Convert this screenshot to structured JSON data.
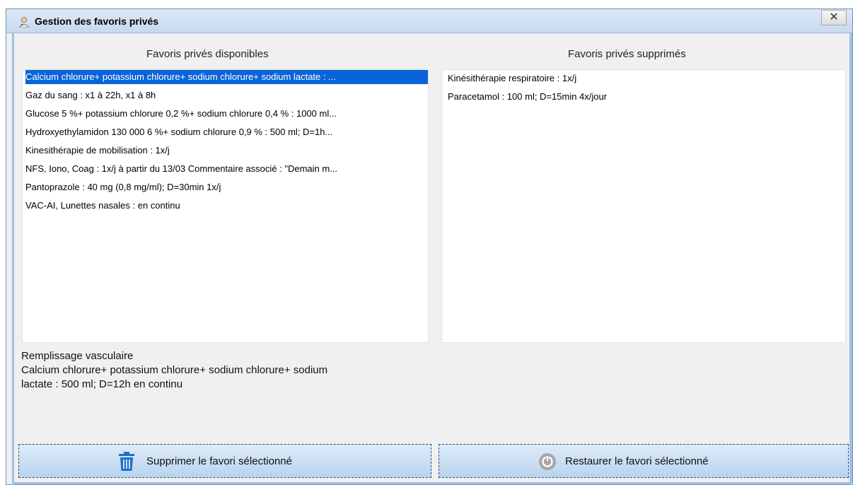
{
  "window": {
    "title": "Gestion des favoris privés",
    "close_label": "✕"
  },
  "left_panel": {
    "title": "Favoris privés disponibles",
    "items": [
      "Calcium chlorure+ potassium chlorure+ sodium chlorure+ sodium lactate : ...",
      "Gaz du sang :  x1 à 22h, x1 à 8h",
      "Glucose 5 %+ potassium chlorure 0,2 %+ sodium chlorure 0,4 % : 1000 ml...",
      "Hydroxyethylamidon 130 000 6 %+ sodium chlorure 0,9 % : 500 ml; D=1h...",
      "Kinesithérapie de mobilisation  :  1x/j",
      "NFS, Iono, Coag :  1x/j à partir du 13/03 Commentaire associé : \"Demain m...",
      "Pantoprazole  : 40 mg (0,8 mg/ml); D=30min 1x/j",
      "VAC-AI, Lunettes nasales :   en continu"
    ],
    "selected_index": 0
  },
  "right_panel": {
    "title": "Favoris privés supprimés",
    "items": [
      "Kinésithérapie respiratoire  :  1x/j",
      "Paracetamol : 100 ml; D=15min 4x/jour"
    ]
  },
  "detail": {
    "heading": "Remplissage vasculaire",
    "line1": "Calcium chlorure+ potassium chlorure+ sodium chlorure+ sodium",
    "line2": "lactate : 500 ml; D=12h  en continu"
  },
  "buttons": {
    "delete_label": "Supprimer le favori sélectionné",
    "restore_label": "Restaurer le favori sélectionné"
  },
  "colors": {
    "selection": "#0a64d8",
    "delete_icon": "#1f6fc7",
    "restore_icon": "#9a9a9a"
  }
}
